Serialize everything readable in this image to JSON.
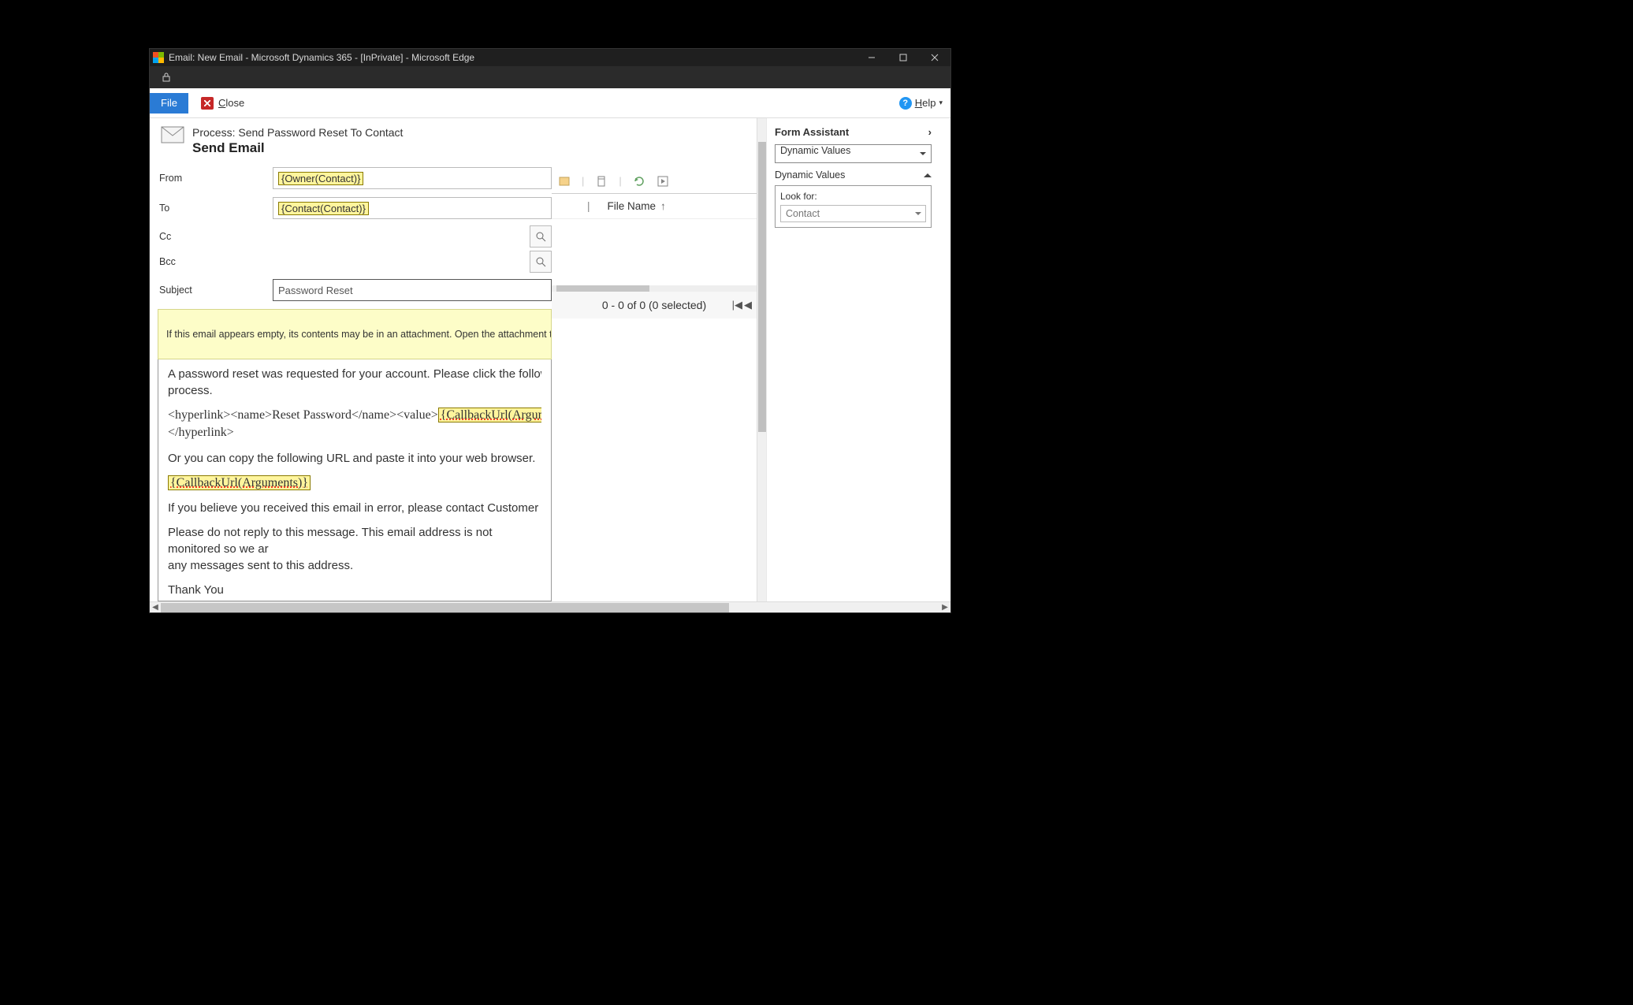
{
  "window": {
    "title": "Email: New Email - Microsoft Dynamics 365 - [InPrivate] - Microsoft Edge"
  },
  "toolbar": {
    "file": "File",
    "close": "Close",
    "help": "Help"
  },
  "header": {
    "process": "Process: Send Password Reset To Contact",
    "action": "Send Email"
  },
  "form": {
    "from_label": "From",
    "from_value": "{Owner(Contact)}",
    "to_label": "To",
    "to_value": "{Contact(Contact)}",
    "cc_label": "Cc",
    "bcc_label": "Bcc",
    "subject_label": "Subject",
    "subject_value": "Password Reset"
  },
  "banner": "If this email appears empty, its contents may be in an attachment. Open the attachment to view the",
  "body": {
    "p1": "A password reset was requested for your account. Please click the following link to complete the process.",
    "p2_prefix": "<hyperlink><name>Reset Password</name><value>",
    "p2_token": "{CallbackUrl(Argum",
    "p2_close": "</hyperlink>",
    "p3": "Or you can copy the following URL and paste it into your web browser.",
    "p4_token": "{CallbackUrl(Arguments)}",
    "p5": "If you believe you received this email in error, please contact Customer Service for assistance.",
    "p6": "Please do not reply to this message. This email address is not monitored so we are unable to respond to any messages sent to this address.",
    "p7": "Thank You"
  },
  "attachments": {
    "column": "File Name",
    "status": "0 - 0 of 0 (0 selected)"
  },
  "assistant": {
    "title": "Form Assistant",
    "mode": "Dynamic Values",
    "sub": "Dynamic Values",
    "lookfor_label": "Look for:",
    "lookfor_value": "Contact"
  }
}
